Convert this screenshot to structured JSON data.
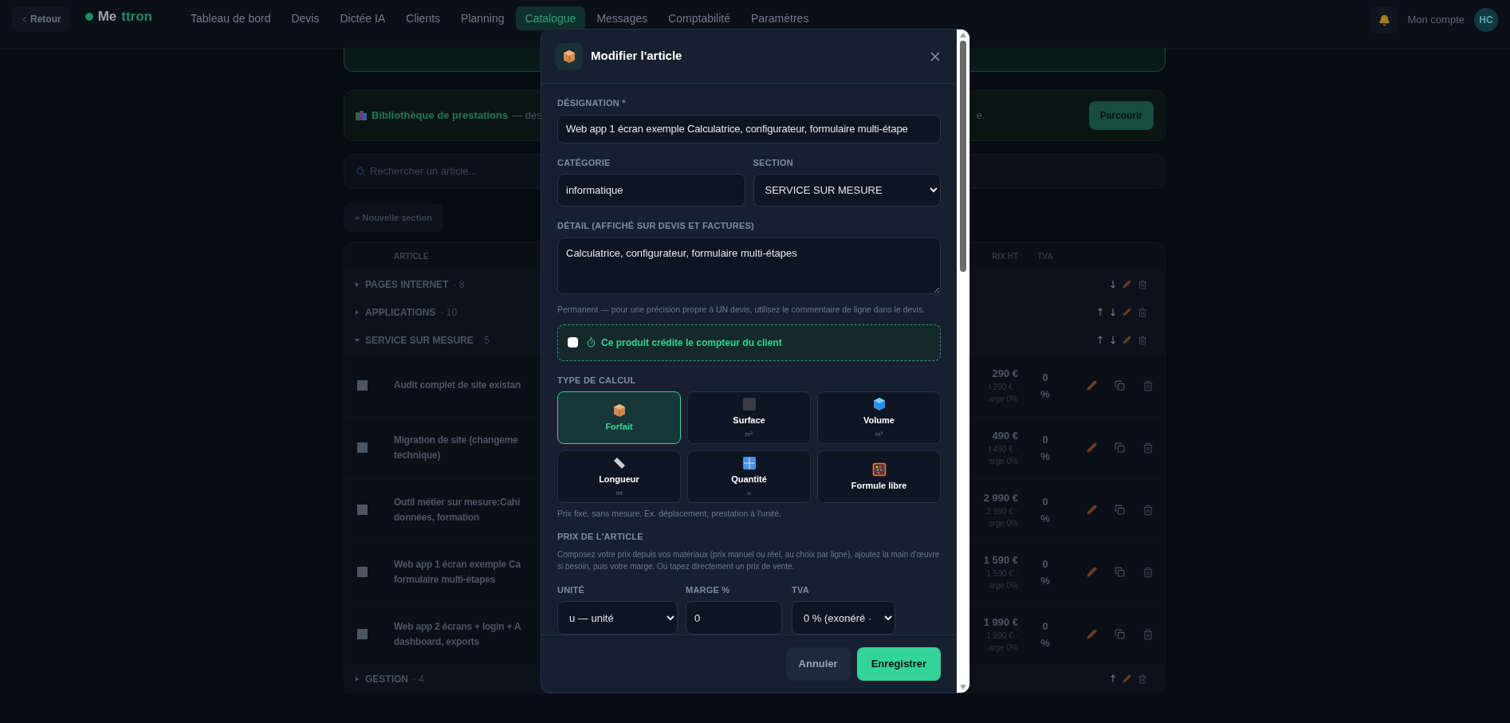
{
  "nav": {
    "back": "Retour",
    "logo": {
      "part_1": "Me",
      "part_2": "ttron"
    },
    "tabs": [
      {
        "label": "Tableau de bord",
        "selected": false
      },
      {
        "label": "Devis",
        "selected": false
      },
      {
        "label": "Dictée IA",
        "selected": false
      },
      {
        "label": "Clients",
        "selected": false
      },
      {
        "label": "Planning",
        "selected": false
      },
      {
        "label": "Catalogue",
        "selected": true
      },
      {
        "label": "Messages",
        "selected": false
      },
      {
        "label": "Comptabilité",
        "selected": false
      },
      {
        "label": "Paramètres",
        "selected": false
      }
    ],
    "account": {
      "label": "Mon compte",
      "initials": "HC"
    }
  },
  "library_card": {
    "title": "Bibliothèque de prestations",
    "text_left": "— des",
    "text_right": "e.",
    "button": "Parcourir"
  },
  "search": {
    "placeholder": "Rechercher un article..."
  },
  "new_section_button": "+ Nouvelle section",
  "table": {
    "columns": [
      "ARTICLE",
      "RIX HT",
      "TVA"
    ],
    "sections": [
      {
        "name": "PAGES INTERNET",
        "count": "· 8",
        "expanded": false,
        "move_up": false,
        "move_down": true
      },
      {
        "name": "APPLICATIONS",
        "count": "· 10",
        "expanded": false,
        "move_up": true,
        "move_down": true
      },
      {
        "name": "SERVICE SUR MESURE",
        "count": "· 5",
        "expanded": true,
        "move_up": true,
        "move_down": true,
        "items": [
          {
            "name_lines": [
              "Audit complet de site existan"
            ],
            "price": "290 €",
            "price_detail": "t 290 € ·",
            "margin": "arge 0%",
            "vat": "0 %",
            "checked": false
          },
          {
            "name_lines": [
              "Migration de site (changeme",
              "technique)"
            ],
            "price": "490 €",
            "price_detail": "t 490 € ·",
            "margin": "arge 0%",
            "vat": "0 %",
            "checked": false
          },
          {
            "name_lines": [
              "Outil métier sur mesure:Cahi",
              "données, formation"
            ],
            "price": "2 990 €",
            "price_detail": "2 990 € ·",
            "margin": "arge 0%",
            "vat": "0 %",
            "checked": false
          },
          {
            "name_lines": [
              "Web app 1 écran exemple Ca",
              "formulaire multi-étapes"
            ],
            "price": "1 590 €",
            "price_detail": "1 590 € ·",
            "margin": "arge 0%",
            "vat": "0 %",
            "checked": false
          },
          {
            "name_lines": [
              "Web app 2 écrans + login + A",
              "dashboard, exports"
            ],
            "price": "1 990 €",
            "price_detail": "1 990 € ·",
            "margin": "arge 0%",
            "vat": "0 %",
            "checked": false
          }
        ]
      },
      {
        "name": "GESTION",
        "count": "· 4",
        "expanded": false,
        "move_up": true,
        "move_down": false
      }
    ]
  },
  "modal": {
    "title": "Modifier l'article",
    "designation": {
      "label": "DÉSIGNATION *",
      "value": "Web app 1 écran exemple Calculatrice, configurateur, formulaire multi-étape"
    },
    "category": {
      "label": "CATÉGORIE",
      "value": "informatique"
    },
    "section": {
      "label": "SECTION",
      "value": "SERVICE SUR MESURE"
    },
    "detail": {
      "label": "DÉTAIL (AFFICHÉ SUR DEVIS ET FACTURES)",
      "value": "Calculatrice, configurateur, formulaire multi-étapes"
    },
    "detail_hint": "Permanent — pour une précision propre à UN devis, utilisez le commentaire de ligne dans le devis.",
    "counter": {
      "label": "Ce produit crédite le compteur du client",
      "checked": false
    },
    "calc_label": "TYPE DE CALCUL",
    "calc_types": [
      {
        "kind": "box",
        "label": "Forfait",
        "selected": true
      },
      {
        "kind": "square",
        "label": "Surface",
        "unit": "m²",
        "selected": false
      },
      {
        "kind": "cube",
        "label": "Volume",
        "unit": "m³",
        "selected": false
      },
      {
        "kind": "ruler",
        "label": "Longueur",
        "unit": "ml",
        "selected": false
      },
      {
        "kind": "numbers",
        "label": "Quantité",
        "unit": "u",
        "selected": false
      },
      {
        "kind": "abacus",
        "label": "Formule libre",
        "selected": false
      }
    ],
    "calc_hint": "Prix fixe, sans mesure. Ex. déplacement, prestation à l'unité.",
    "price_label": "PRIX DE L'ARTICLE",
    "price_desc": "Composez votre prix depuis vos matériaux (prix manuel ou réel, au choix par ligne), ajoutez la main d'œuvre si besoin, puis votre marge. Ou tapez directement un prix de vente.",
    "unit": {
      "label": "UNITÉ",
      "value": "u — unité"
    },
    "margin": {
      "label": "MARGE %",
      "value": "0"
    },
    "vat": {
      "label": "TVA",
      "value": "0 % (exonéré ·"
    },
    "cancel": "Annuler",
    "save": "Enregistrer"
  }
}
